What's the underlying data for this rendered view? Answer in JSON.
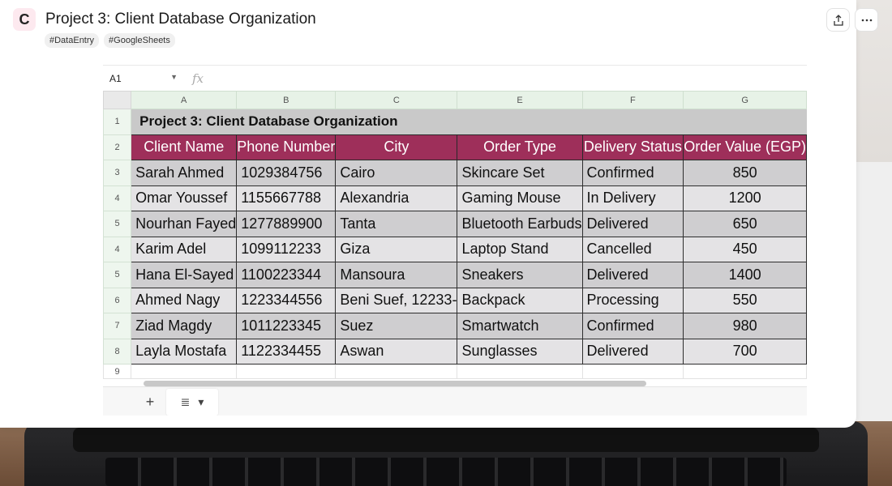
{
  "window": {
    "title": "Project 3: Client Database Organization",
    "logo_letter": "C",
    "tags": [
      "#DataEntry",
      "#GoogleSheets"
    ],
    "icons": {
      "share": "share-icon",
      "more": "more-icon"
    }
  },
  "spreadsheet": {
    "name_box": "A1",
    "fx_label": "fx",
    "columns": [
      "A",
      "B",
      "C",
      "E",
      "F",
      "G"
    ],
    "row_numbers": [
      "1",
      "2",
      "3",
      "4",
      "5",
      "4",
      "5",
      "6",
      "7",
      "8",
      "9"
    ],
    "title_cell": "Project 3: Client Database Organization",
    "headers": [
      "Client Name",
      "Phone Number",
      "City",
      "Order Type",
      "Delivery Status",
      "Order Value (EGP)"
    ],
    "rows": [
      [
        "Sarah Ahmed",
        "1029384756",
        "Cairo",
        "Skincare Set",
        "Confirmed",
        "850"
      ],
      [
        "Omar Youssef",
        "1155667788",
        "Alexandria",
        "Gaming Mouse",
        "In Delivery",
        "1200"
      ],
      [
        "Nourhan Fayed",
        "1277889900",
        "Tanta",
        "Bluetooth Earbuds",
        "Delivered",
        "650"
      ],
      [
        "Karim Adel",
        "1099112233",
        "Giza",
        "Laptop Stand",
        "Cancelled",
        "450"
      ],
      [
        "Hana El-Sayed",
        "1100223344",
        "Mansoura",
        "Sneakers",
        "Delivered",
        "1400"
      ],
      [
        "Ahmed Nagy",
        "1223344556",
        "Beni Suef, 12233-",
        "Backpack",
        "Processing",
        "550"
      ],
      [
        "Ziad Magdy",
        "1011223345",
        "Suez",
        "Smartwatch",
        "Confirmed",
        "980"
      ],
      [
        "Layla Mostafa",
        "1122334455",
        "Aswan",
        "Sunglasses",
        "Delivered",
        "700"
      ]
    ],
    "colors": {
      "header_bg": "#9e2f5a",
      "header_text": "#ffffff",
      "row_odd": "#cfced0",
      "row_even": "#e4e3e5",
      "column_header_bg": "#e7f2e7"
    },
    "sheet_tabs": {
      "add": "+",
      "list_icon": "≣",
      "dropdown": "▾"
    }
  }
}
